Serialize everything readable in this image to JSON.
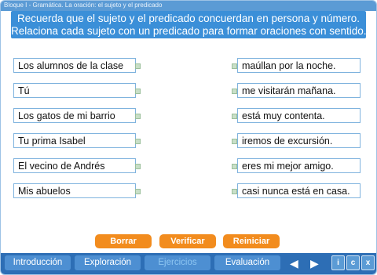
{
  "header": {
    "breadcrumb": "Bloque I -  Gramática. La oración: el sujeto y el predicado"
  },
  "instructions": [
    "Recuerda que el sujeto y el predicado concuerdan en persona y número.",
    "Relaciona cada sujeto con un predicado para formar oraciones con sentido."
  ],
  "subjects": [
    "Los alumnos de la clase",
    "Tú",
    "Los gatos de mi barrio",
    "Tu prima Isabel",
    "El vecino de Andrés",
    "Mis abuelos"
  ],
  "predicates": [
    "maúllan por la noche.",
    "me visitarán mañana.",
    "está muy contenta.",
    "iremos de excursión.",
    "eres mi mejor amigo.",
    "casi nunca está en casa."
  ],
  "buttons": {
    "erase": "Borrar",
    "check": "Verificar",
    "restart": "Reiniciar"
  },
  "nav": {
    "tabs": [
      "Introducción",
      "Exploración",
      "Ejercicios",
      "Evaluación"
    ],
    "active": "Ejercicios",
    "info": "i",
    "capture": "c",
    "close": "x",
    "prev_arrow": "◀",
    "next_arrow": "▶"
  }
}
